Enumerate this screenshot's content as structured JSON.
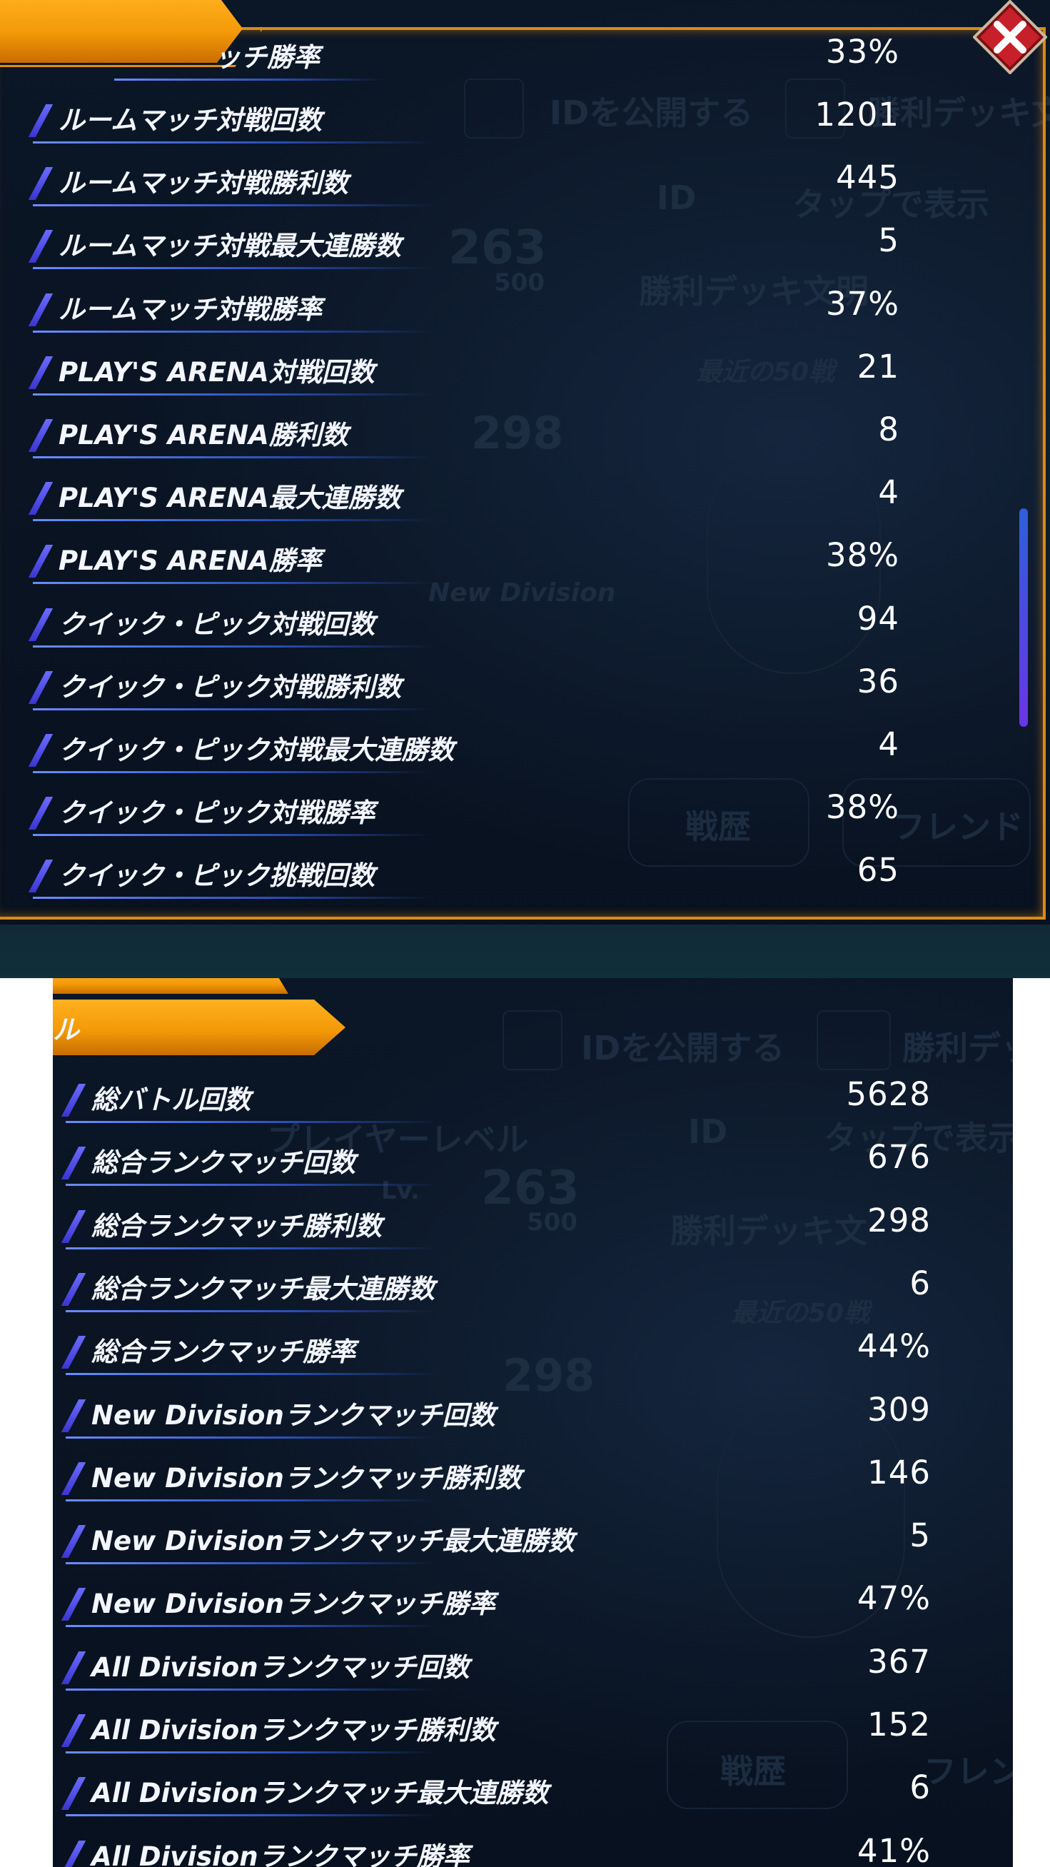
{
  "top_panel": {
    "header_partial": "ッチ勝率",
    "header_value": "33%",
    "rows": [
      {
        "label": "ルームマッチ対戦回数",
        "value": "1201"
      },
      {
        "label": "ルームマッチ対戦勝利数",
        "value": "445"
      },
      {
        "label": "ルームマッチ対戦最大連勝数",
        "value": "5"
      },
      {
        "label": "ルームマッチ対戦勝率",
        "value": "37%"
      },
      {
        "label": "PLAY'S ARENA対戦回数",
        "value": "21"
      },
      {
        "label": "PLAY'S ARENA勝利数",
        "value": "8"
      },
      {
        "label": "PLAY'S ARENA最大連勝数",
        "value": "4"
      },
      {
        "label": "PLAY'S ARENA勝率",
        "value": "38%"
      },
      {
        "label": "クイック・ピック対戦回数",
        "value": "94"
      },
      {
        "label": "クイック・ピック対戦勝利数",
        "value": "36"
      },
      {
        "label": "クイック・ピック対戦最大連勝数",
        "value": "4"
      },
      {
        "label": "クイック・ピック対戦勝率",
        "value": "38%"
      },
      {
        "label": "クイック・ピック挑戦回数",
        "value": "65"
      }
    ],
    "ghost": {
      "publish_id": "IDを公開する",
      "deck_partial": "勝利デッキ文",
      "id_label": "ID",
      "tap_to_show": "タップで表示",
      "level_value": "263",
      "level_max": "500",
      "deck_desc": "勝利デッキ文明",
      "recent_50": "最近の50戦",
      "rank_value": "298",
      "new_division": "New Division",
      "history": "戦歴",
      "friend_partial": "フレンド"
    }
  },
  "bottom_panel": {
    "tab_partial": "ル",
    "rows": [
      {
        "label": "総バトル回数",
        "value": "5628"
      },
      {
        "label": "総合ランクマッチ回数",
        "value": "676"
      },
      {
        "label": "総合ランクマッチ勝利数",
        "value": "298"
      },
      {
        "label": "総合ランクマッチ最大連勝数",
        "value": "6"
      },
      {
        "label": "総合ランクマッチ勝率",
        "value": "44%"
      },
      {
        "label": "New Divisionランクマッチ回数",
        "value": "309"
      },
      {
        "label": "New Divisionランクマッチ勝利数",
        "value": "146"
      },
      {
        "label": "New Divisionランクマッチ最大連勝数",
        "value": "5"
      },
      {
        "label": "New Divisionランクマッチ勝率",
        "value": "47%"
      },
      {
        "label": "All Divisionランクマッチ回数",
        "value": "367"
      },
      {
        "label": "All Divisionランクマッチ勝利数",
        "value": "152"
      },
      {
        "label": "All Divisionランクマッチ最大連勝数",
        "value": "6"
      },
      {
        "label": "All Divisionランクマッチ勝率",
        "value": "41%"
      }
    ],
    "ghost": {
      "publish_id": "IDを公開する",
      "deck_partial": "勝利デッキ",
      "id_label": "ID",
      "tap_to_show": "タップで表示",
      "player_level": "プレイヤーレベル",
      "lv": "Lv.",
      "level_value": "263",
      "level_max": "500",
      "deck_desc": "勝利デッキ文",
      "recent_50": "最近の50戦",
      "rank_value": "298",
      "history": "戦歴",
      "friend_partial": "フレン"
    }
  },
  "colors": {
    "accent_orange": "#f49a08",
    "row_accent": "#5a5cff",
    "scrollbar": "#4a4ae0",
    "close_red": "#c8202a"
  },
  "icons": {
    "close": "close-x-icon"
  }
}
